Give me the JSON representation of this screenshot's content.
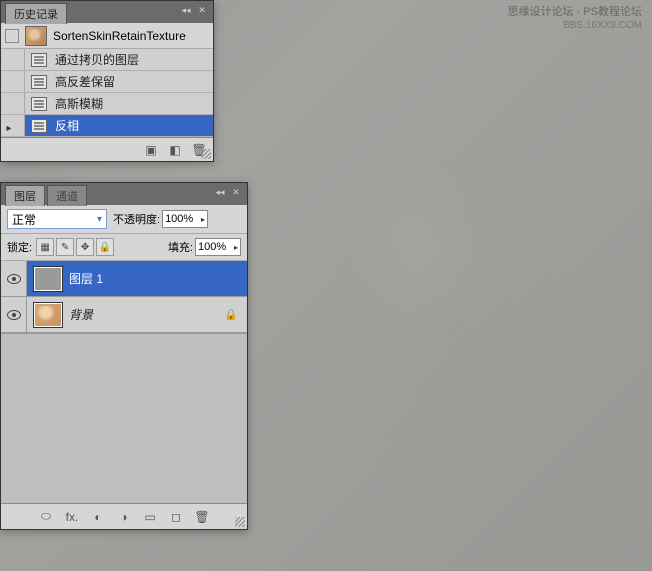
{
  "watermark": {
    "line1": "思缘设计论坛 · PS教程论坛",
    "line2": "BBS.16XX8.COM"
  },
  "history": {
    "title": "历史记录",
    "snapshot_name": "SortenSkinRetainTexture",
    "items": [
      {
        "label": "通过拷贝的图层"
      },
      {
        "label": "高反差保留"
      },
      {
        "label": "高斯模糊"
      },
      {
        "label": "反相"
      }
    ]
  },
  "layers": {
    "tab_layers": "图层",
    "tab_channels": "通道",
    "blend_mode": "正常",
    "opacity_label": "不透明度:",
    "opacity_value": "100%",
    "lock_label": "锁定:",
    "fill_label": "填充:",
    "fill_value": "100%",
    "items": [
      {
        "name": "图层 1"
      },
      {
        "name": "背景"
      }
    ]
  }
}
